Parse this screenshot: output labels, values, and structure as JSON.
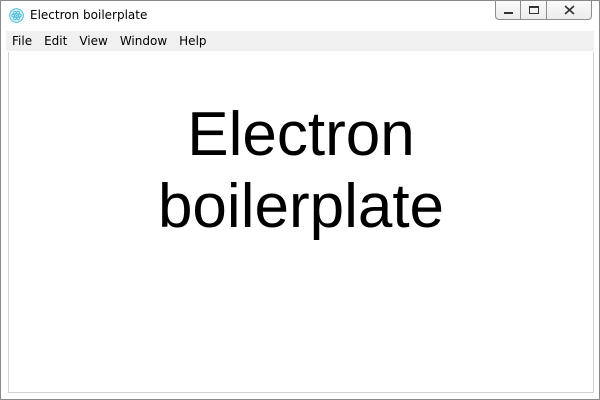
{
  "window": {
    "title": "Electron boilerplate",
    "app_icon": "electron-atom-icon",
    "controls": [
      "minimize-icon",
      "maximize-icon",
      "close-icon"
    ]
  },
  "menubar": {
    "items": [
      {
        "label": "File"
      },
      {
        "label": "Edit"
      },
      {
        "label": "View"
      },
      {
        "label": "Window"
      },
      {
        "label": "Help"
      }
    ]
  },
  "content": {
    "heading_line1": "Electron",
    "heading_line2": "boilerplate"
  },
  "colors": {
    "menubar_bg": "#f0f0f0",
    "icon_accent": "#47b8d6",
    "text": "#000000"
  }
}
